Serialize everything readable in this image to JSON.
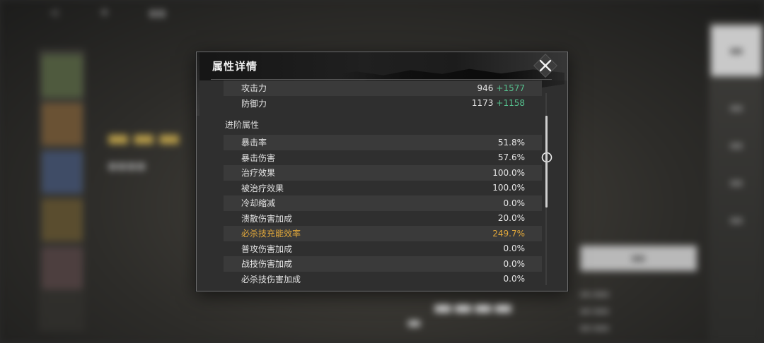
{
  "modal": {
    "title": "属性详情",
    "base_stats": [
      {
        "label": "攻击力",
        "value": "946",
        "bonus": "+1577"
      },
      {
        "label": "防御力",
        "value": "1173",
        "bonus": "+1158"
      }
    ],
    "advanced_section_title": "进阶属性",
    "advanced_stats": [
      {
        "label": "暴击率",
        "value": "51.8%"
      },
      {
        "label": "暴击伤害",
        "value": "57.6%",
        "warning": true
      },
      {
        "label": "治疗效果",
        "value": "100.0%"
      },
      {
        "label": "被治疗效果",
        "value": "100.0%"
      },
      {
        "label": "冷却缩减",
        "value": "0.0%"
      },
      {
        "label": "溃散伤害加成",
        "value": "20.0%"
      },
      {
        "label": "必杀技充能效率",
        "value": "249.7%",
        "highlight": true
      },
      {
        "label": "普攻伤害加成",
        "value": "0.0%"
      },
      {
        "label": "战技伤害加成",
        "value": "0.0%"
      },
      {
        "label": "必杀技伤害加成",
        "value": "0.0%"
      }
    ]
  },
  "icons": {
    "close": "close-icon",
    "warning": "exclamation-circle-icon"
  },
  "colors": {
    "bonus_green": "#56c08e",
    "highlight_orange": "#e3a93b",
    "panel_bg": "#2f2f2f"
  }
}
